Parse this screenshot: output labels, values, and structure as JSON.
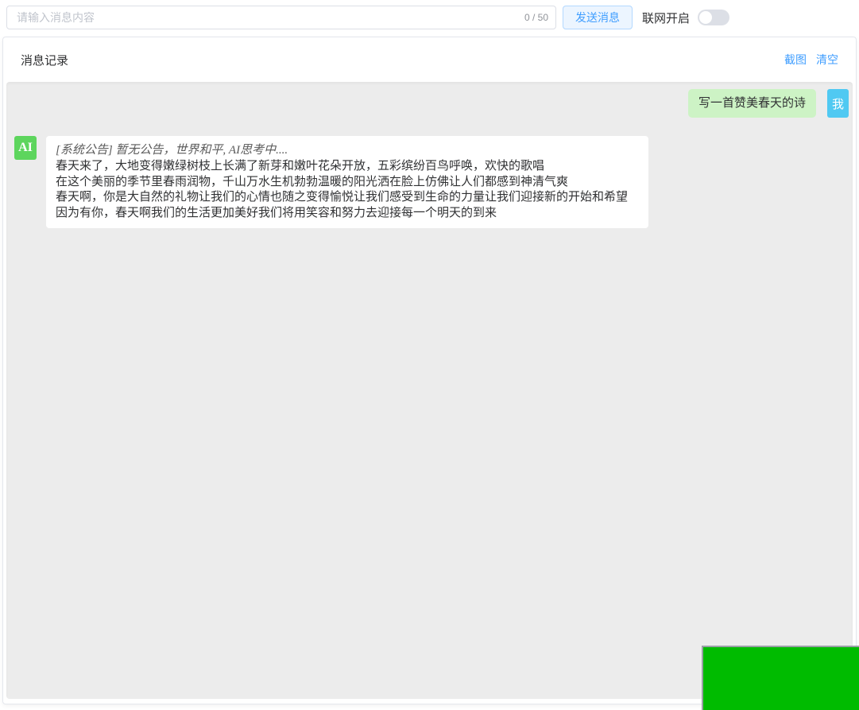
{
  "composer": {
    "input": {
      "placeholder": "请输入消息内容",
      "value": "",
      "counter": "0 / 50"
    },
    "send_button_label": "发送消息",
    "network_label": "联网开启",
    "network_switch_on": false
  },
  "panel": {
    "title": "消息记录",
    "screenshot_link": "截图",
    "clear_link": "清空"
  },
  "chat": {
    "user_message": {
      "text": "写一首赞美春天的诗",
      "avatar": "我"
    },
    "ai_message": {
      "avatar": "AI",
      "notice": "[系统公告] 暂无公告，世界和平, AI思考中....",
      "lines": [
        "春天来了，大地变得嫩绿树枝上长满了新芽和嫩叶花朵开放，五彩缤纷百鸟呼唤，欢快的歌唱",
        "在这个美丽的季节里春雨润物，千山万水生机勃勃温暖的阳光洒在脸上仿佛让人们都感到神清气爽",
        "春天啊，你是大自然的礼物让我们的心情也随之变得愉悦让我们感受到生命的力量让我们迎接新的开始和希望",
        "因为有你，春天啊我们的生活更加美好我们将用笑容和努力去迎接每一个明天的到来"
      ]
    }
  },
  "colors": {
    "accent_blue": "#409eff",
    "user_bubble_green": "#cdf3c5",
    "user_avatar_blue": "#50c9f2",
    "ai_avatar_green": "#5dd55d",
    "video_green": "#00bb00",
    "chat_background": "#ececec"
  }
}
